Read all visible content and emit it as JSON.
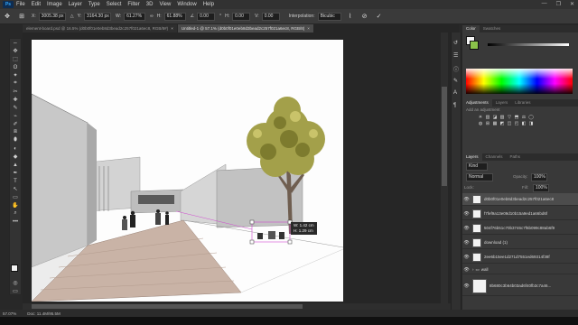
{
  "app": {
    "logo": "Ps"
  },
  "menu": [
    "File",
    "Edit",
    "Image",
    "Layer",
    "Type",
    "Select",
    "Filter",
    "3D",
    "View",
    "Window",
    "Help"
  ],
  "window_controls": [
    "—",
    "❐",
    "✕"
  ],
  "options_bar": {
    "x_value": "3005.38 px",
    "y_value": "3164.30 px",
    "w_value": "61.27%",
    "h_value": "61.88%",
    "angle_value": "0.00",
    "hskew_value": "0.00",
    "vskew_value": "0.00",
    "interpolation_label": "Interpolation:",
    "interpolation_value": "Bicubic",
    "x_label": "X:",
    "y_label": "Y:",
    "w_label": "W:",
    "h_label": "H:",
    "h_skew_label": "H:",
    "v_skew_label": "V:",
    "angle_symbol": "∠",
    "degree_symbol": "°",
    "cancel_symbol": "⊘",
    "commit_symbol": "✓"
  },
  "tabs": [
    {
      "label": "element-board.psd @ 16.5% (d0b0f01e0eb8d3bead2c257f021a6ec8, RGB/8#)",
      "active": false
    },
    {
      "label": "Untitled-1 @ 57.1% (d0b0f01e0eb8d3bead2c257f021a6ec8, RGB/8)",
      "active": true
    }
  ],
  "tab_close": "×",
  "tools": [
    "⇔",
    "⬚",
    "ʘ",
    "✦",
    "⌗",
    "✂",
    "✚",
    "✎",
    "⌁",
    "✐",
    "⧈",
    "⬮",
    "◐",
    "◆",
    "▲",
    "T",
    "↖",
    "▭",
    "✋",
    "⌕",
    "•••"
  ],
  "transform_readout": {
    "w": "W: 1.42 cm",
    "h": "H: 1.29 cm"
  },
  "statusbar": {
    "zoom": "57.07%",
    "doc": "Doc: 11.4M/95.5M"
  },
  "color_panel": {
    "tabs": [
      "Color",
      "Swatches"
    ],
    "fg": "#f5f5f5",
    "bg": "#8bc34a"
  },
  "adjustments_panel": {
    "tabs": [
      "Adjustments",
      "Layers",
      "Libraries"
    ],
    "hint": "Add an adjustment",
    "icons": [
      "☀",
      "▥",
      "◪",
      "▨",
      "▽",
      "⬒",
      "⚖",
      "◯",
      "◍",
      "⊞",
      "▦",
      "◩",
      "◫",
      "◰",
      "◧",
      "◨"
    ]
  },
  "layers_panel": {
    "tabs": [
      "Layers",
      "Channels",
      "Paths"
    ],
    "kind": "Kind",
    "blend_mode": "Normal",
    "opacity_label": "Opacity:",
    "opacity": "100%",
    "lock_label": "Lock:",
    "fill_label": "Fill:",
    "fill": "100%",
    "visibility_symbol": "👁",
    "group_fold_symbol": "›",
    "layers": [
      {
        "name": "d0b0f01e0eb8d3bead2c257f021a6ec8",
        "selected": true
      },
      {
        "name": "f7fef9a13e09d10b15a9ed1a66bd6f",
        "selected": false
      },
      {
        "name": "504f76b51c70b3746c7f6b099c88ab6f9",
        "selected": false
      },
      {
        "name": "download (1)",
        "selected": false
      },
      {
        "name": "2ee6b15ee1d271d7551ed69314f38f",
        "selected": false
      },
      {
        "name": "wall",
        "selected": false,
        "group": true
      },
      {
        "name": "8b680c3b64b03ad6f40fb3c7a46...",
        "selected": false
      }
    ]
  }
}
